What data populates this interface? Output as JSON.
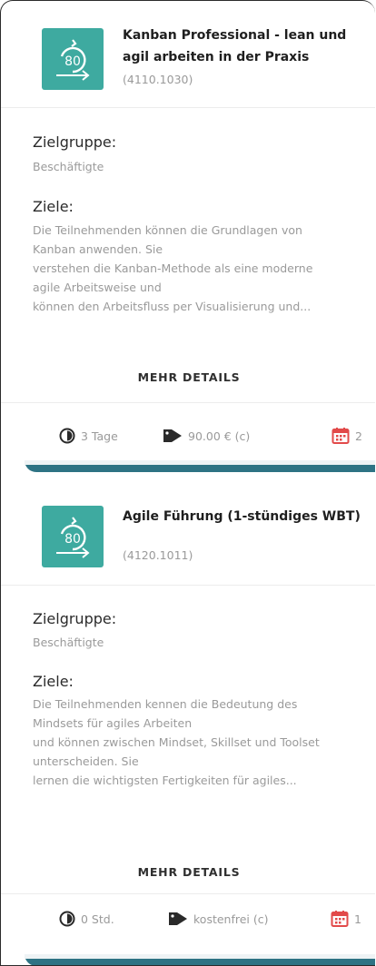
{
  "courses": [
    {
      "title": "Kanban Professional - lean und agil arbeiten in der Praxis",
      "code": "(4110.1030)",
      "zielgruppe_label": "Zielgruppe:",
      "zielgruppe_value": "Beschäftigte",
      "ziele_label": "Ziele:",
      "ziele_lines": [
        "Die Teilnehmenden können die Grundlagen von",
        "Kanban anwenden. Sie",
        "verstehen die Kanban-Methode als eine moderne",
        "agile Arbeitsweise und",
        "können den Arbeitsfluss per Visualisierung und..."
      ],
      "more_label": "MEHR DETAILS",
      "duration": "3 Tage",
      "price": "90.00 € (c)",
      "dates_count": "2"
    },
    {
      "title": "Agile Führung (1-stündiges WBT)",
      "code": "(4120.1011)",
      "zielgruppe_label": "Zielgruppe:",
      "zielgruppe_value": "Beschäftigte",
      "ziele_label": "Ziele:",
      "ziele_lines": [
        "Die Teilnehmenden kennen die Bedeutung des",
        "Mindsets für agiles Arbeiten",
        "und können zwischen Mindset, Skillset und Toolset",
        "unterscheiden. Sie",
        "lernen die wichtigsten Fertigkeiten für agiles..."
      ],
      "more_label": "MEHR DETAILS",
      "duration": "0 Std.",
      "price": "kostenfrei (c)",
      "dates_count": "1"
    }
  ],
  "icons": {
    "thumbnail": "360-rotation-icon",
    "duration": "clock-half-icon",
    "price": "price-tag-icon",
    "dates": "calendar-icon"
  },
  "colors": {
    "accent": "#3eaaa0",
    "bar": "#2e7384",
    "calendar": "#e24a4a"
  }
}
